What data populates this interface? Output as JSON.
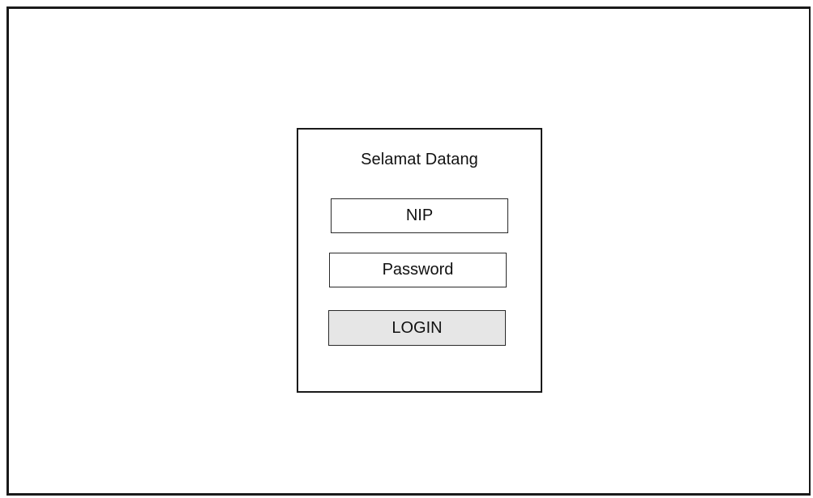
{
  "login_panel": {
    "title": "Selamat Datang",
    "nip_field": {
      "placeholder": "NIP"
    },
    "password_field": {
      "placeholder": "Password"
    },
    "login_button": {
      "label": "LOGIN",
      "background": "#e6e6e6"
    }
  }
}
